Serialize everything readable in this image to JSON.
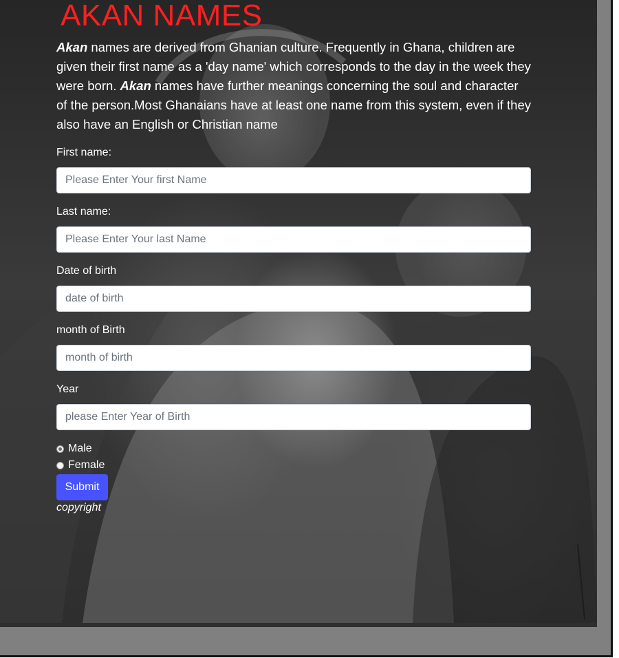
{
  "page": {
    "title": "AKAN NAMES",
    "intro": {
      "akan_word_1": "Akan",
      "text_1": " names are derived from Ghanian culture. Frequently in Ghana, children are given their first name as a 'day name' which corresponds to the day in the week they were born. ",
      "akan_word_2": "Akan",
      "text_2": " names have further meanings concerning the soul and character of the person.Most Ghanaians have at least one name from this system, even if they also have an English or Christian name"
    }
  },
  "form": {
    "first_name": {
      "label": "First name:",
      "placeholder": "Please Enter Your first Name"
    },
    "last_name": {
      "label": "Last name:",
      "placeholder": "Please Enter Your last Name"
    },
    "date_of_birth": {
      "label": "Date of birth",
      "placeholder": "date of birth"
    },
    "month_of_birth": {
      "label": "month of Birth",
      "placeholder": "month of birth"
    },
    "year": {
      "label": "Year",
      "placeholder": "please Enter Year of Birth"
    },
    "gender": {
      "options": [
        {
          "label": "Male",
          "checked": true
        },
        {
          "label": "Female",
          "checked": false
        }
      ]
    },
    "submit_label": "Submit"
  },
  "footer": {
    "copyright": "copyright"
  },
  "colors": {
    "title": "#ff1f1f",
    "submit_button": "#4853ff",
    "page_gray": "#808080"
  },
  "background": {
    "icon": "charcoal-portrait-mother-and-child-image"
  }
}
